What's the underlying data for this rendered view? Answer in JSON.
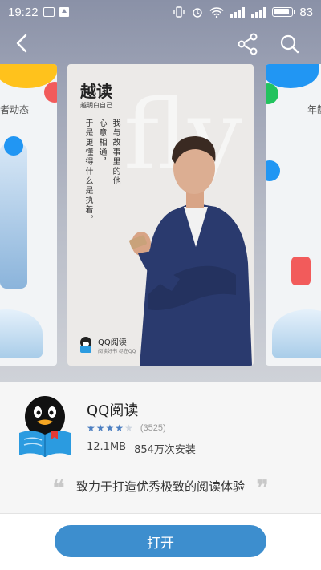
{
  "status_bar": {
    "time": "19:22",
    "battery": "83"
  },
  "header": {
    "back_icon": "back-arrow-icon",
    "share_icon": "share-icon",
    "search_icon": "search-icon"
  },
  "gallery": {
    "left_caption": "者动态",
    "right_caption": "年龄",
    "main": {
      "title": "越读",
      "subtitle": "越明白自己",
      "poem_col1": "我与故事里的他",
      "poem_col2": "心意相通，",
      "poem_col3": "于是更懂得什么是执着。",
      "deco": "fly",
      "logo_text": "QQ阅读",
      "logo_sub": "阅读好书 尽在QQ"
    }
  },
  "app": {
    "name": "QQ阅读",
    "rating_stars": 4,
    "rating_count": "(3525)",
    "size": "12.1MB",
    "installs": "854万次安装",
    "tagline": "致力于打造优秀极致的阅读体验",
    "open_label": "打开"
  },
  "colors": {
    "accent": "#3d8ece",
    "star": "#4d7fc1"
  }
}
